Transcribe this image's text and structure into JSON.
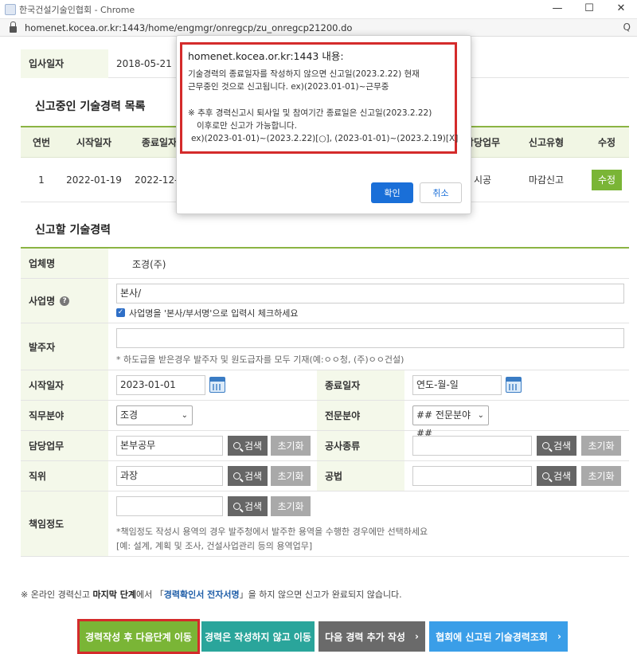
{
  "browser": {
    "window_title": "한국건설기술인협회 - Chrome",
    "url": "homenet.kocea.or.kr:1443/home/engmgr/onregcp/zu_onregcp21200.do",
    "min_glyph": "—",
    "max_glyph": "☐",
    "close_glyph": "✕",
    "side_glyph": "Q"
  },
  "top_row": {
    "label": "입사일자",
    "value": "2018-05-21"
  },
  "current_section": {
    "title": "신고중인 기술경력 목록",
    "headers": [
      "연번",
      "시작일자",
      "종료일자",
      "담당업무",
      "신고유형",
      "수정"
    ],
    "row": {
      "no": "1",
      "start": "2022-01-19",
      "end": "2022-12-3",
      "duty": "시공",
      "type": "마감신고",
      "edit_label": "수정"
    }
  },
  "form_section": {
    "title": "신고할 기술경력",
    "company": {
      "label": "업체명",
      "value": "조경(주)"
    },
    "business": {
      "label": "사업명",
      "help_glyph": "?",
      "value": "본사/",
      "checkbox_glyph": "✓",
      "checkbox_label": "사업명을 '본사/부서명'으로 입력시 체크하세요"
    },
    "client": {
      "label": "발주자",
      "value": "",
      "hint": "* 하도급을 받은경우 발주자 및 원도급자를 모두 기재(예:ㅇㅇ청, (주)ㅇㅇ건설)"
    },
    "start_date": {
      "label": "시작일자",
      "value": "2023-01-01"
    },
    "end_date": {
      "label": "종료일자",
      "placeholder": "연도-월-일"
    },
    "job_field": {
      "label": "직무분야",
      "value": "조경"
    },
    "specialty": {
      "label": "전문분야",
      "value": "## 전문분야 ##"
    },
    "duty": {
      "label": "담당업무",
      "value": "본부공무"
    },
    "work_type": {
      "label": "공사종류",
      "value": ""
    },
    "position": {
      "label": "직위",
      "value": "과장"
    },
    "method": {
      "label": "공법",
      "value": ""
    },
    "responsibility": {
      "label": "책임정도",
      "value": "",
      "hint1": "*책임정도 작성시 용역의 경우 발주청에서 발주한 용역을 수행한 경우에만 선택하세요",
      "hint2": "[예: 설계, 계획 및 조사, 건설사업관리 등의 용역업무]"
    },
    "search_label": "검색",
    "reset_label": "초기화",
    "chevron": "⌄"
  },
  "notice": {
    "prefix": "※ 온라인 경력신고 ",
    "bold": "마지막 단계",
    "middle": "에서 「",
    "blue": "경력확인서 전자서명",
    "suffix": "」을 하지 않으면 신고가 완료되지 않습니다."
  },
  "bottom_buttons": {
    "next_step": "경력작성 후 다음단계 이동",
    "skip": "경력은 작성하지 않고 이동",
    "add_next": "다음 경력 추가 작성",
    "lookup": "협회에 신고된 기술경력조회",
    "arrow": "›"
  },
  "dialog": {
    "title": "homenet.kocea.or.kr:1443 내용:",
    "line1": "기술경력의 종료일자를 작성하지 않으면 신고일(2023.2.22) 현재",
    "line2": "근무중인 것으로 신고됩니다. ex)(2023.01-01)~근무중",
    "line3": "※ 추후 경력신고시 퇴사일 및 참여기간 종료일은 신고일(2023.2.22)",
    "line4": "이후로만 신고가 가능합니다.",
    "line5": "ex)(2023-01-01)~(2023.2.22)[○], (2023-01-01)~(2023.2.19)[X]",
    "ok": "확인",
    "cancel": "취소"
  },
  "colors": {
    "accent_green": "#7ab536",
    "highlight_red": "#d42b2b",
    "primary_blue": "#1a6fd8"
  }
}
